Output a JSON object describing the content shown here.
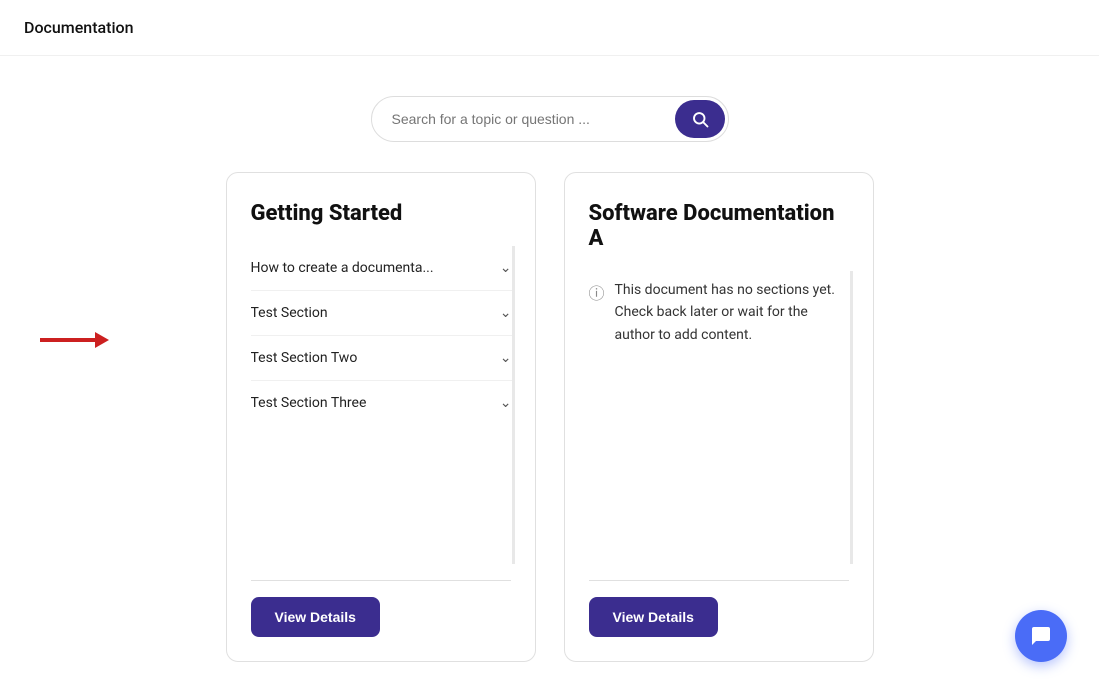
{
  "nav": {
    "title": "Documentation"
  },
  "search": {
    "placeholder": "Search for a topic or question ...",
    "value": ""
  },
  "cards": [
    {
      "id": "getting-started",
      "title": "Getting Started",
      "sections": [
        {
          "label": "How to create a documenta..."
        },
        {
          "label": "Test Section"
        },
        {
          "label": "Test Section Two"
        },
        {
          "label": "Test Section Three"
        }
      ],
      "view_details_label": "View Details",
      "type": "sections"
    },
    {
      "id": "software-doc-a",
      "title": "Software Documentation A",
      "type": "empty",
      "empty_message": "This document has no sections yet. Check back later or wait for the author to add content.",
      "view_details_label": "View Details"
    }
  ],
  "chat_button_label": "chat"
}
